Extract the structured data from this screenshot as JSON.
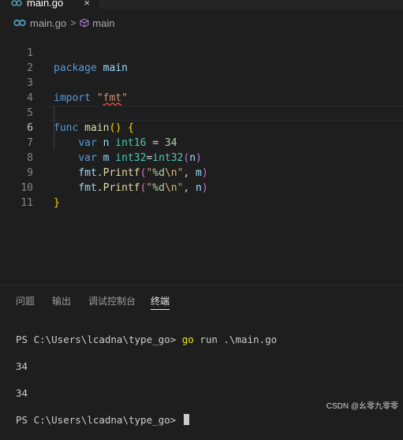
{
  "tab": {
    "label": "main.go",
    "close": "×"
  },
  "breadcrumb": {
    "file": "main.go",
    "separator": ">",
    "symbol": "main"
  },
  "editor": {
    "line_numbers": [
      "1",
      "2",
      "3",
      "4",
      "5",
      "6",
      "7",
      "8",
      "9",
      "10",
      "11"
    ],
    "active_line": "6",
    "code": {
      "l1_kw": "package",
      "l1_name": "main",
      "l3_kw": "import",
      "l3_str_q1": "\"",
      "l3_str": "fmt",
      "l3_str_q2": "\"",
      "l5_kw": "func",
      "l5_fn": "main",
      "l5_paren": "()",
      "l5_brace": "{",
      "l6_kw": "var",
      "l6_var": "n",
      "l6_type": "int16",
      "l6_eq": "=",
      "l6_num": "34",
      "l7_kw": "var",
      "l7_var": "m",
      "l7_type": "int32",
      "l7_eq": "=",
      "l7_fn": "int32",
      "l7_p1": "(",
      "l7_arg": "n",
      "l7_p2": ")",
      "l8_pkg": "fmt",
      "l8_dot": ".",
      "l8_fn": "Printf",
      "l8_p1": "(",
      "l8_q1": "\"",
      "l8_fmt": "%d",
      "l8_esc": "\\n",
      "l8_q2": "\"",
      "l8_comma": ", ",
      "l8_arg": "m",
      "l8_p2": ")",
      "l9_pkg": "fmt",
      "l9_dot": ".",
      "l9_fn": "Printf",
      "l9_p1": "(",
      "l9_q1": "\"",
      "l9_fmt": "%d",
      "l9_esc": "\\n",
      "l9_q2": "\"",
      "l9_comma": ", ",
      "l9_arg": "n",
      "l9_p2": ")",
      "l10_brace": "}"
    }
  },
  "panel": {
    "tabs": [
      "问题",
      "输出",
      "调试控制台",
      "终端"
    ],
    "active_tab": "终端"
  },
  "terminal": {
    "prompt1": "PS C:\\Users\\lcadna\\type_go> ",
    "command": "go",
    "command_args": " run .\\main.go",
    "out1": "34",
    "out2": "34",
    "prompt2": "PS C:\\Users\\lcadna\\type_go> "
  },
  "watermark": "CSDN @幺零九零零"
}
